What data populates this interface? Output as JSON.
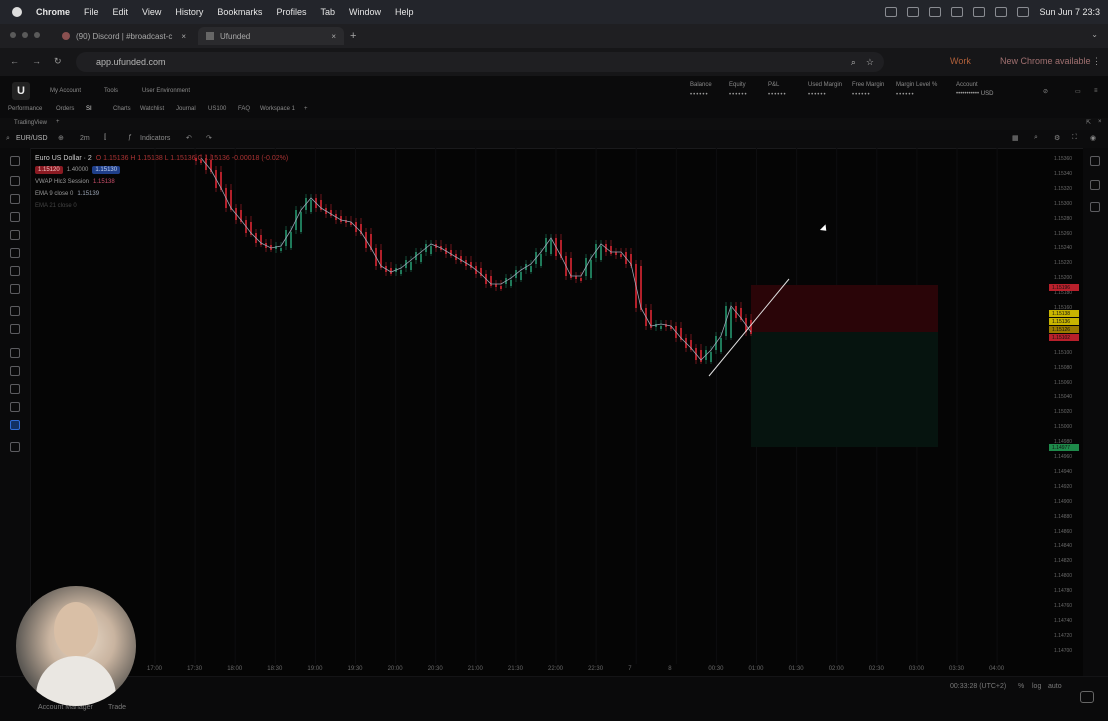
{
  "macbar": {
    "app": "Chrome",
    "menus": [
      "File",
      "Edit",
      "View",
      "History",
      "Bookmarks",
      "Profiles",
      "Tab",
      "Window",
      "Help"
    ],
    "datetime": "Sun Jun 7  23:3"
  },
  "tabs": [
    {
      "title": "(90) Discord | #broadcast-c"
    },
    {
      "title": "Ufunded"
    }
  ],
  "address": {
    "url": "app.ufunded.com",
    "profile": "Work",
    "update": "New Chrome available"
  },
  "header": {
    "logo": "U",
    "menus": [
      "My Account",
      "Tools",
      "User Environment"
    ],
    "stats": [
      {
        "label": "Balance",
        "value": "••••••"
      },
      {
        "label": "Equity",
        "value": "••••••"
      },
      {
        "label": "P&L",
        "value": "••••••"
      },
      {
        "label": "Used Margin",
        "value": "••••••"
      },
      {
        "label": "Free Margin",
        "value": "••••••"
      },
      {
        "label": "Margin Level %",
        "value": "••••••"
      }
    ],
    "account_label": "Account",
    "account_value": "••••••••••• USD",
    "subnav": [
      "Performance",
      "Orders",
      "SI",
      "Charts",
      "Watchlist",
      "Journal",
      "US100",
      "FAQ",
      "Workspace 1"
    ]
  },
  "tradingview": {
    "label": "TradingView"
  },
  "toolbar": {
    "symbol": "EUR/USD",
    "interval": "2m",
    "indicators": "Indicators"
  },
  "legend": {
    "title": "Euro US Dollar · 2",
    "ohlc": "O 1.15136  H 1.15138  L 1.15136  C 1.15136  -0.00018 (-0.02%)",
    "bid": "1.15120",
    "spread": "1.40000",
    "ask": "1.15130",
    "vwap_label": "VWAP Hlc3 Session",
    "vwap_value": "1.15138",
    "ema_label": "EMA 9 close 0",
    "ema_value": "1.15139",
    "extra": "EMA 21  close 0"
  },
  "y_ticks": [
    "1.15360",
    "1.15340",
    "1.15320",
    "1.15300",
    "1.15280",
    "1.15260",
    "1.15240",
    "1.15220",
    "1.15200",
    "1.15180",
    "1.15160",
    "1.15140",
    "1.15120",
    "1.15100",
    "1.15080",
    "1.15060",
    "1.15040",
    "1.15020",
    "1.15000",
    "1.14980",
    "1.14960",
    "1.14940",
    "1.14920",
    "1.14900",
    "1.14880",
    "1.14860",
    "1.14840",
    "1.14820",
    "1.14800",
    "1.14780",
    "1.14760",
    "1.14740",
    "1.14720",
    "1.14700"
  ],
  "y_badges": [
    {
      "text": "1.15196",
      "color": "#b8202b"
    },
    {
      "text": "1.15138",
      "color": "#c8b400"
    },
    {
      "text": "1.15136",
      "color": "#c8b400"
    },
    {
      "text": "1.15126",
      "color": "#9a7a00"
    },
    {
      "text": "1.15102",
      "color": "#b8202b"
    },
    {
      "text": "1.14977",
      "color": "#1e8a4a"
    }
  ],
  "x_ticks": [
    "17:00",
    "17:30",
    "18:00",
    "18:30",
    "19:00",
    "19:30",
    "20:00",
    "20:30",
    "21:00",
    "21:30",
    "22:00",
    "22:30",
    "7",
    "8",
    "00:30",
    "01:00",
    "01:30",
    "02:00",
    "02:30",
    "03:00",
    "03:30",
    "04:00"
  ],
  "bottom": {
    "time": "00:33:28 (UTC+2)",
    "pct": "%",
    "log": "log",
    "auto": "auto",
    "tabs": [
      "Account Manager",
      "Trade"
    ]
  },
  "colors": {
    "up": "#1f7a5a",
    "down": "#b3202a",
    "ema": "#9aa4b4",
    "vwap": "#c94f6a",
    "stop_zone": "#2a0508",
    "target_zone": "#06140f"
  }
}
